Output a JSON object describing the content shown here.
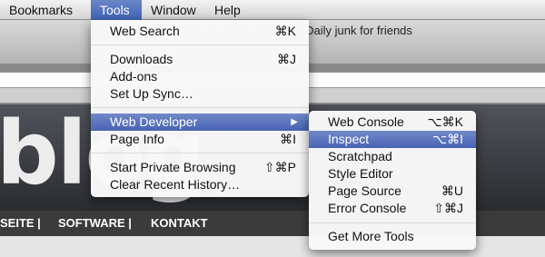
{
  "menubar": {
    "items": [
      {
        "label": "Bookmarks"
      },
      {
        "label": "Tools"
      },
      {
        "label": "Window"
      },
      {
        "label": "Help"
      }
    ]
  },
  "browser": {
    "window_title": "blog - Daily junk for friends",
    "logo_text": "blog",
    "nav": [
      "SEITE |",
      "SOFTWARE |",
      "KONTAKT"
    ]
  },
  "tools_menu": {
    "web_search": {
      "label": "Web Search",
      "shortcut": "⌘K"
    },
    "downloads": {
      "label": "Downloads",
      "shortcut": "⌘J"
    },
    "addons": {
      "label": "Add-ons"
    },
    "setup_sync": {
      "label": "Set Up Sync…"
    },
    "web_developer": {
      "label": "Web Developer",
      "arrow": "▶"
    },
    "page_info": {
      "label": "Page Info",
      "shortcut": "⌘I"
    },
    "private_browsing": {
      "label": "Start Private Browsing",
      "shortcut": "⇧⌘P"
    },
    "clear_history": {
      "label": "Clear Recent History…"
    }
  },
  "web_dev_menu": {
    "web_console": {
      "label": "Web Console",
      "shortcut": "⌥⌘K"
    },
    "inspect": {
      "label": "Inspect",
      "shortcut": "⌥⌘I"
    },
    "scratchpad": {
      "label": "Scratchpad"
    },
    "style_editor": {
      "label": "Style Editor"
    },
    "page_source": {
      "label": "Page Source",
      "shortcut": "⌘U"
    },
    "error_console": {
      "label": "Error Console",
      "shortcut": "⇧⌘J"
    },
    "get_more_tools": {
      "label": "Get More Tools"
    }
  },
  "colors": {
    "highlight": "#4a66b6",
    "menubar": "#e4e4e4"
  }
}
